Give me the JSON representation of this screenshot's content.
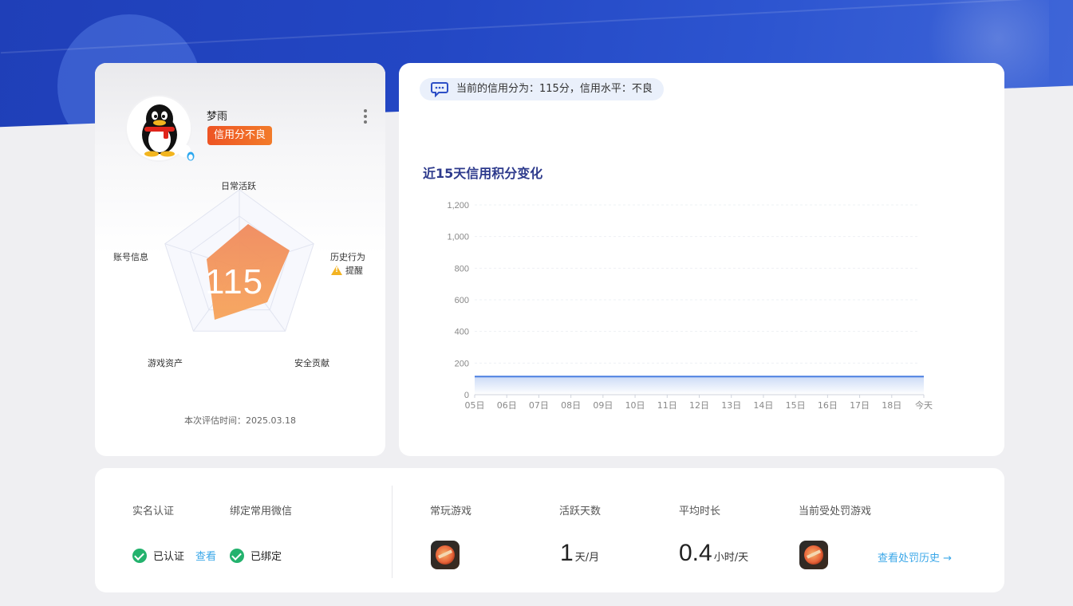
{
  "profile": {
    "username": "梦雨",
    "credit_badge": "信用分不良",
    "score": "115",
    "radar_labels": {
      "top": "日常活跃",
      "right": "历史行为",
      "bottom_right": "安全贡献",
      "bottom_left": "游戏资产",
      "left": "账号信息"
    },
    "warning_label": "提醒",
    "eval_time": "本次评估时间：2025.03.18"
  },
  "notice": {
    "text": "当前的信用分为：115分，信用水平：不良"
  },
  "chart_data": {
    "type": "area",
    "title": "近15天信用积分变化",
    "xlabel": "",
    "ylabel": "",
    "ylim": [
      0,
      1200
    ],
    "y_ticks": [
      "0",
      "200",
      "400",
      "600",
      "800",
      "1,000",
      "1,200"
    ],
    "categories": [
      "05日",
      "06日",
      "07日",
      "08日",
      "09日",
      "10日",
      "11日",
      "12日",
      "13日",
      "14日",
      "15日",
      "16日",
      "17日",
      "18日",
      "今天"
    ],
    "series": [
      {
        "values": [
          115,
          115,
          115,
          115,
          115,
          115,
          115,
          115,
          115,
          115,
          115,
          115,
          115,
          115,
          115
        ]
      }
    ],
    "grid": true,
    "line_color": "#4a7fe0"
  },
  "stats": {
    "real_name": {
      "label": "实名认证",
      "value": "已认证",
      "link": "查看"
    },
    "wechat": {
      "label": "绑定常用微信",
      "value": "已绑定"
    },
    "frequent_game": {
      "label": "常玩游戏"
    },
    "active_days": {
      "label": "活跃天数",
      "value": "1",
      "unit": "天/月"
    },
    "avg_duration": {
      "label": "平均时长",
      "value": "0.4",
      "unit": "小时/天"
    },
    "penalty_game": {
      "label": "当前受处罚游戏",
      "link": "查看处罚历史 →"
    }
  },
  "colors": {
    "accent": "#ee5424",
    "primary_blue": "#2347c4",
    "success": "#23b26d",
    "link": "#3aa7e8"
  }
}
